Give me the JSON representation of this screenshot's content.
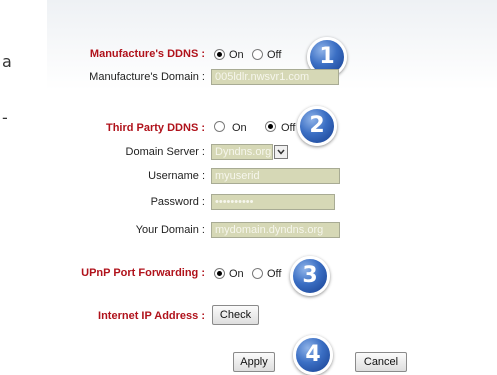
{
  "left_fragments": {
    "char_a": "a",
    "char_dash": "-"
  },
  "manufacturer_ddns": {
    "label": "Manufacture's DDNS :",
    "on_label": "On",
    "off_label": "Off",
    "selected": "On"
  },
  "manufacturer_domain": {
    "label": "Manufacture's Domain :",
    "value": "005ldlr.nwsvr1.com"
  },
  "third_party_ddns": {
    "label": "Third Party DDNS :",
    "on_label": "On",
    "off_label": "Off",
    "selected": "Off"
  },
  "domain_server": {
    "label": "Domain Server :",
    "value": "Dyndns.org"
  },
  "username": {
    "label": "Username :",
    "value": "myuserid"
  },
  "password": {
    "label": "Password :",
    "value": "••••••••••"
  },
  "your_domain": {
    "label": "Your Domain :",
    "value": "mydomain.dyndns.org"
  },
  "upnp": {
    "label": "UPnP Port Forwarding :",
    "on_label": "On",
    "off_label": "Off",
    "selected": "On"
  },
  "internet_ip": {
    "label": "Internet IP Address :",
    "check_label": "Check"
  },
  "actions": {
    "apply_label": "Apply",
    "cancel_label": "Cancel"
  },
  "badges": [
    "1",
    "2",
    "3",
    "4"
  ],
  "colors": {
    "section_label": "#b0121b",
    "badge_blue": "#3b6fc4",
    "field_bg": "#d6d8b6"
  }
}
